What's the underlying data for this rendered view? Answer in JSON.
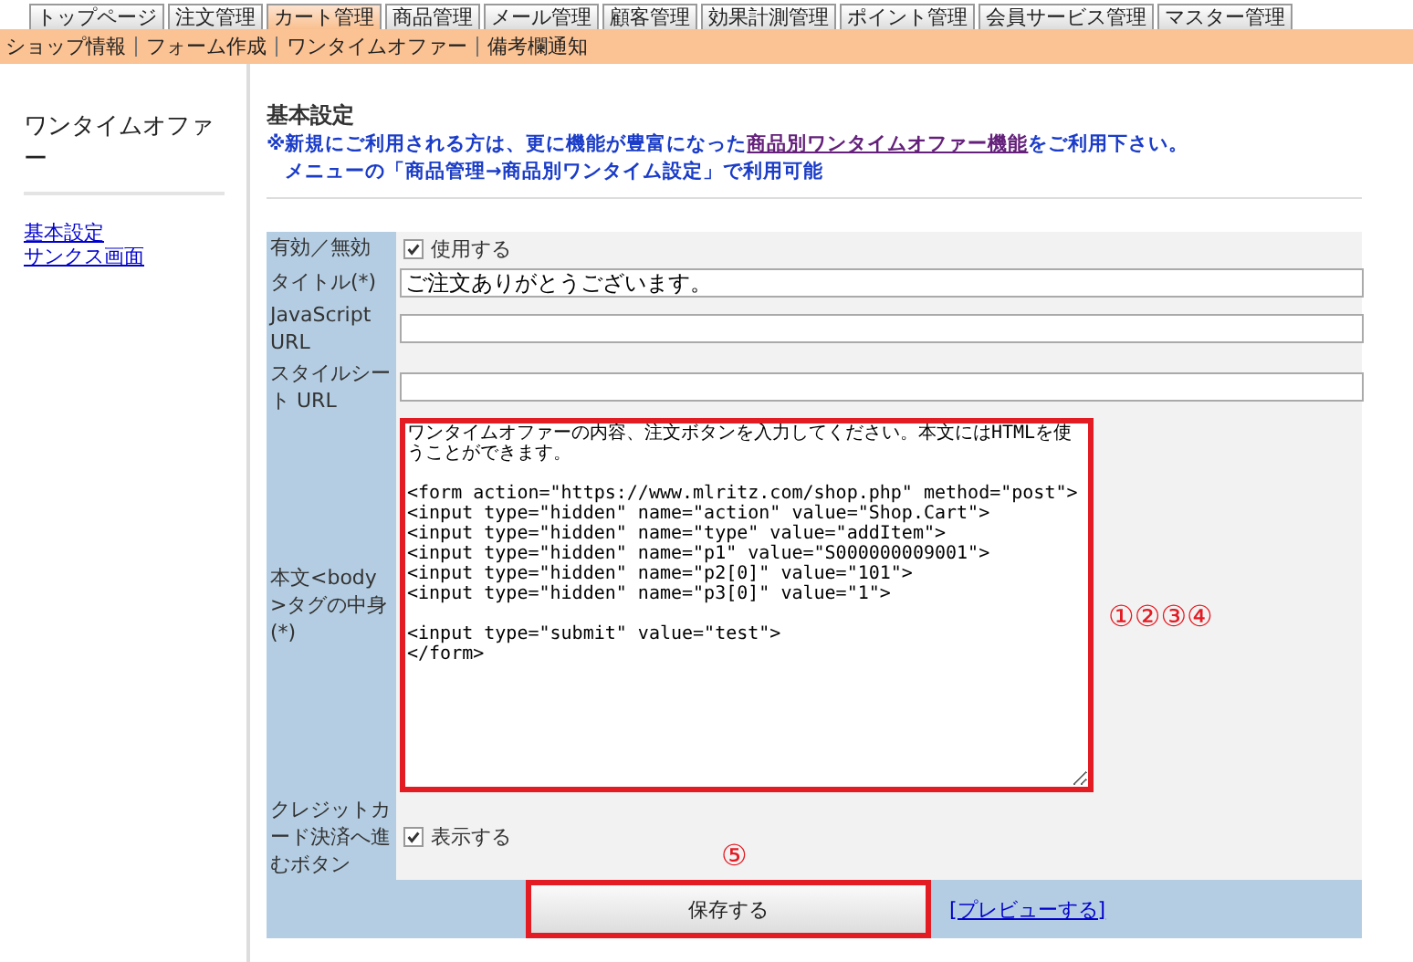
{
  "tabs": [
    {
      "label": "トップページ",
      "selected": false
    },
    {
      "label": "注文管理",
      "selected": false
    },
    {
      "label": "カート管理",
      "selected": true
    },
    {
      "label": "商品管理",
      "selected": false
    },
    {
      "label": "メール管理",
      "selected": false
    },
    {
      "label": "顧客管理",
      "selected": false
    },
    {
      "label": "効果計測管理",
      "selected": false
    },
    {
      "label": "ポイント管理",
      "selected": false
    },
    {
      "label": "会員サービス管理",
      "selected": false
    },
    {
      "label": "マスター管理",
      "selected": false
    }
  ],
  "subnav": [
    "ショップ情報",
    "フォーム作成",
    "ワンタイムオファー",
    "備考欄通知"
  ],
  "sidebar": {
    "title": "ワンタイムオファー",
    "links": [
      "基本設定",
      "サンクス画面"
    ]
  },
  "main": {
    "heading": "基本設定",
    "notice": {
      "before": "※新規にご利用される方は、更に機能が豊富になった",
      "link": "商品別ワンタイムオファー機能",
      "after": "をご利用下さい。",
      "line2": "メニューの「商品管理→商品別ワンタイム設定」で利用可能"
    },
    "rows": [
      {
        "kind": "checkbox",
        "label": "有効／無効",
        "option": "使用する",
        "checked": true
      },
      {
        "kind": "text",
        "label": "タイトル(*)",
        "value": "ご注文ありがとうございます。"
      },
      {
        "kind": "text",
        "label": "JavaScript URL"
      },
      {
        "kind": "text",
        "label": "スタイルシート URL"
      },
      {
        "kind": "textarea",
        "label": "本文<body>タグの中身(*)",
        "value": "ワンタイムオファーの内容、注文ボタンを入力してください。本文にはHTMLを使うことができます。\n\n<form action=\"https://www.mlritz.com/shop.php\" method=\"post\">\n<input type=\"hidden\" name=\"action\" value=\"Shop.Cart\">\n<input type=\"hidden\" name=\"type\" value=\"addItem\">\n<input type=\"hidden\" name=\"p1\" value=\"S000000009001\">\n<input type=\"hidden\" name=\"p2[0]\" value=\"101\">\n<input type=\"hidden\" name=\"p3[0]\" value=\"1\">\n\n<input type=\"submit\" value=\"test\">\n</form>",
        "annotation": "①②③④"
      },
      {
        "kind": "checkbox",
        "label": "クレジットカード決済へ進むボタン",
        "option": "表示する",
        "checked": true
      }
    ],
    "save_annotation": "⑤",
    "save_button": "保存する",
    "preview_link": "[プレビューする]"
  }
}
